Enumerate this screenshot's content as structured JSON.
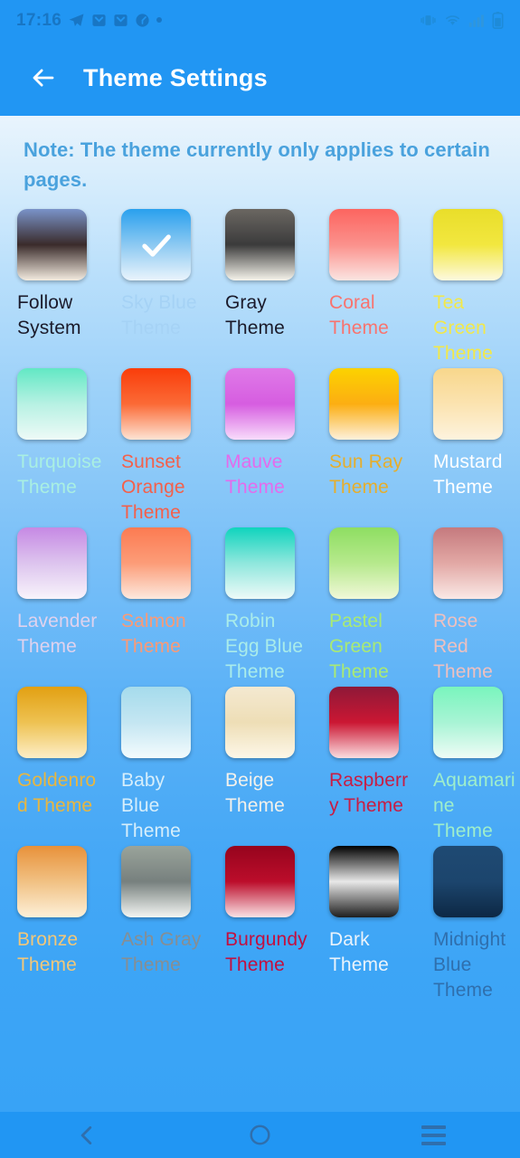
{
  "status_bar": {
    "time": "17:16",
    "left_icons": [
      "telegram-icon",
      "mail-badge-icon",
      "mail-badge-icon",
      "clock-icon",
      "dot-icon"
    ],
    "right_icons": [
      "vibrate-icon",
      "wifi-icon",
      "signal-icon",
      "battery-icon"
    ]
  },
  "app_bar": {
    "back_icon": "arrow-left-icon",
    "title": "Theme Settings",
    "bg_color": "#2196f3",
    "title_color": "#ffffff"
  },
  "content": {
    "note": "Note: The theme currently only applies to certain pages.",
    "note_color": "#4aa2dd"
  },
  "themes": [
    {
      "name": "Follow System",
      "label_color": "#1b1b2b",
      "from": "#7a93c9",
      "mid": "#3a2b2b",
      "to": "#f4ece0",
      "selected": false
    },
    {
      "name": "Sky Blue Theme",
      "label_color": "#a5d2f5",
      "from": "#29a0ee",
      "mid": "#8cc9f2",
      "to": "#eaf4fc",
      "selected": true
    },
    {
      "name": "Gray Theme",
      "label_color": "#1b1b2b",
      "from": "#6b6762",
      "mid": "#3b3b3b",
      "to": "#f6f4ec",
      "selected": false
    },
    {
      "name": "Coral Theme",
      "label_color": "#f9736e",
      "from": "#fc6560",
      "mid": "#fb918c",
      "to": "#fbe5e2",
      "selected": false
    },
    {
      "name": "Tea Green Theme",
      "label_color": "#f2e84a",
      "from": "#e9de2a",
      "mid": "#f2e73f",
      "to": "#fdf9df",
      "selected": false
    },
    {
      "name": "Turquoise Theme",
      "label_color": "#a9efe2",
      "from": "#62e8c4",
      "mid": "#b7f1e3",
      "to": "#eefaf7",
      "selected": false
    },
    {
      "name": "Sunset Orange Theme",
      "label_color": "#f4604a",
      "from": "#fa3d0a",
      "mid": "#fb6a36",
      "to": "#fde4d4",
      "selected": false
    },
    {
      "name": "Mauve Theme",
      "label_color": "#e46bec",
      "from": "#df7ae8",
      "mid": "#d65de0",
      "to": "#f8dcfb",
      "selected": false
    },
    {
      "name": "Sun Ray Theme",
      "label_color": "#e6ae2c",
      "from": "#fcd200",
      "mid": "#fcae12",
      "to": "#fdf1dc",
      "selected": false
    },
    {
      "name": "Mustard Theme",
      "label_color": "#ffffff",
      "from": "#f8d78c",
      "mid": "#fbe3b0",
      "to": "#fdf3de",
      "selected": false
    },
    {
      "name": "Lavender Theme",
      "label_color": "#dfd2ee",
      "from": "#c689e4",
      "mid": "#ddc4ee",
      "to": "#f8f4fb",
      "selected": false
    },
    {
      "name": "Salmon Theme",
      "label_color": "#fb9a76",
      "from": "#fc7b52",
      "mid": "#fc9c78",
      "to": "#fde9de",
      "selected": false
    },
    {
      "name": "Robin Egg Blue Theme",
      "label_color": "#a9ecea",
      "from": "#0fd4bd",
      "mid": "#8fe7dd",
      "to": "#eefaf8",
      "selected": false
    },
    {
      "name": "Pastel Green Theme",
      "label_color": "#a9ea74",
      "from": "#8ede62",
      "mid": "#b6e98c",
      "to": "#f1f8d9",
      "selected": false
    },
    {
      "name": "Rose Red Theme",
      "label_color": "#edc0c0",
      "from": "#c57a7e",
      "mid": "#e2a8a5",
      "to": "#fae9e6",
      "selected": false
    },
    {
      "name": "Goldenrod Theme",
      "label_color": "#e8b640",
      "from": "#e2a012",
      "mid": "#eec252",
      "to": "#fdeec7",
      "selected": false
    },
    {
      "name": "Baby Blue Theme",
      "label_color": "#d6eefb",
      "from": "#a5dbec",
      "mid": "#c4e6f2",
      "to": "#f3fbfd",
      "selected": false
    },
    {
      "name": "Beige Theme",
      "label_color": "#f3f1eb",
      "from": "#f4e9d1",
      "mid": "#eedeb6",
      "to": "#fdf7e8",
      "selected": false
    },
    {
      "name": "Raspberry Theme",
      "label_color": "#c81d44",
      "from": "#8e1838",
      "mid": "#cb1733",
      "to": "#fbdde0",
      "selected": false
    },
    {
      "name": "Aquamarine Theme",
      "label_color": "#9eeecb",
      "from": "#79f5bd",
      "mid": "#a8f4d5",
      "to": "#effcf6",
      "selected": false
    },
    {
      "name": "Bronze Theme",
      "label_color": "#f2c779",
      "from": "#e8913a",
      "mid": "#f1c183",
      "to": "#fdf0d9",
      "selected": false
    },
    {
      "name": "Ash Gray Theme",
      "label_color": "#868e93",
      "from": "#9aa49b",
      "mid": "#77807e",
      "to": "#f4f6f3",
      "selected": false
    },
    {
      "name": "Burgundy Theme",
      "label_color": "#c21040",
      "from": "#96041d",
      "mid": "#bc0d2b",
      "to": "#fae2e5",
      "selected": false
    },
    {
      "name": "Dark Theme",
      "label_color": "#eaf3fb",
      "from": "#000000",
      "mid": "#e8e8e8",
      "to": "#1e1e1e",
      "selected": false
    },
    {
      "name": "Midnight Blue Theme",
      "label_color": "#2f6fad",
      "from": "#1f4a73",
      "mid": "#1c456d",
      "to": "#0d2844",
      "selected": false
    }
  ],
  "nav_bar": {
    "back_icon": "chevron-left-icon",
    "home_icon": "circle-icon",
    "recents_icon": "hamburger-icon",
    "icon_color": "#2f6fad",
    "bg_color": "#2196f3"
  }
}
